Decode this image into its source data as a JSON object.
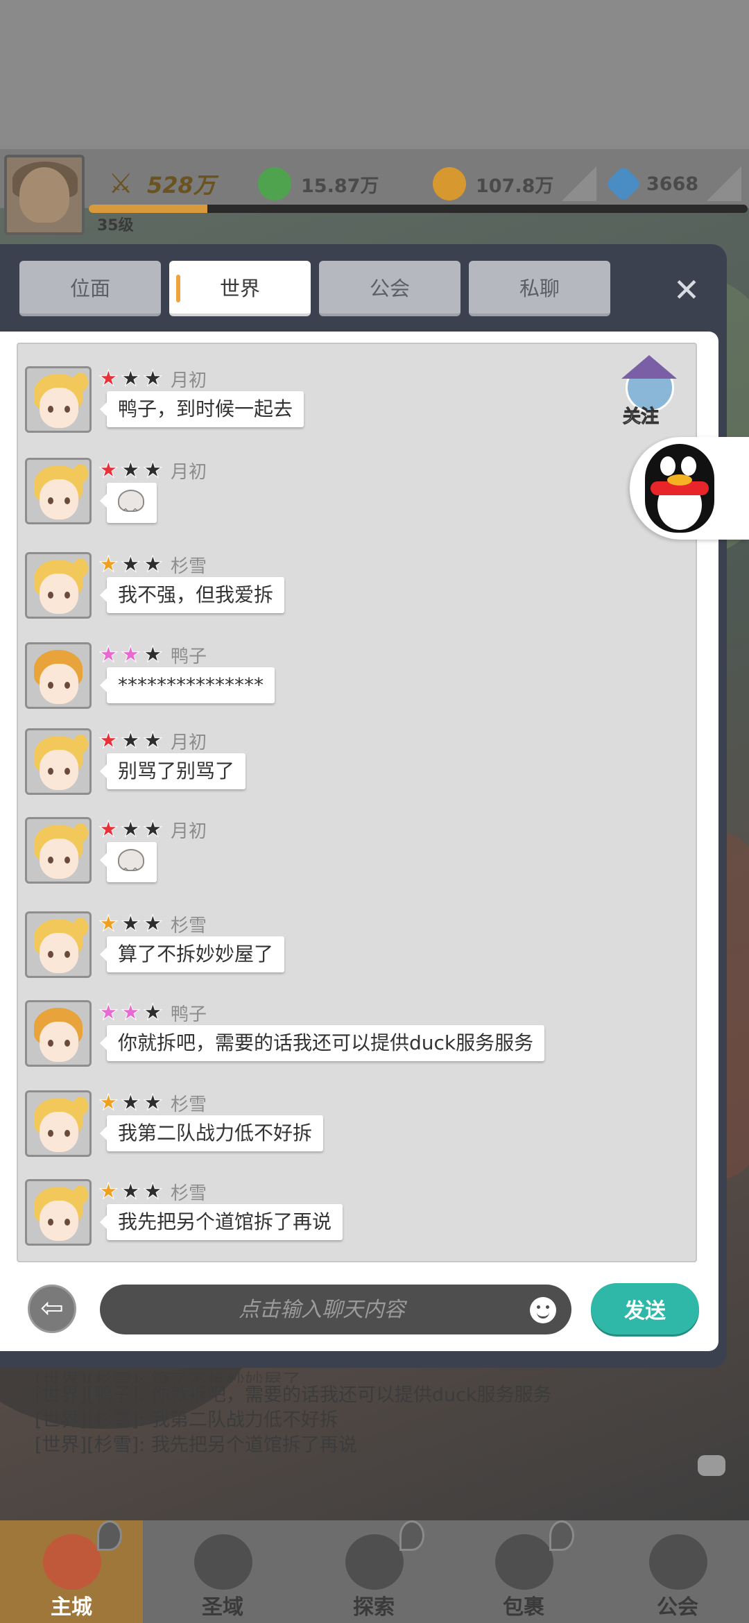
{
  "resources": {
    "power": "528万",
    "green_currency": "15.87万",
    "gold": "107.8万",
    "gem": "3668",
    "level": "35级",
    "exp_progress": 0.18
  },
  "tabs": [
    {
      "label": "位面",
      "active": false
    },
    {
      "label": "世界",
      "active": true
    },
    {
      "label": "公会",
      "active": false
    },
    {
      "label": "私聊",
      "active": false
    }
  ],
  "follow": {
    "label": "关注"
  },
  "messages": [
    {
      "name": "月初",
      "text": "鸭子，到时候一起去",
      "stars": [
        "#e8323a",
        "#2e2e2e",
        "#2e2e2e"
      ],
      "avatar": "blonde",
      "emoji": false
    },
    {
      "name": "月初",
      "text": "",
      "stars": [
        "#e8323a",
        "#2e2e2e",
        "#2e2e2e"
      ],
      "avatar": "blonde",
      "emoji": true
    },
    {
      "name": "杉雪",
      "text": "我不强，但我爱拆",
      "stars": [
        "#f0a020",
        "#2e2e2e",
        "#2e2e2e"
      ],
      "avatar": "blonde",
      "emoji": false
    },
    {
      "name": "鸭子",
      "text": "***************",
      "stars": [
        "#e86ad0",
        "#e86ad0",
        "#2e2e2e"
      ],
      "avatar": "boy",
      "emoji": false
    },
    {
      "name": "月初",
      "text": "别骂了别骂了",
      "stars": [
        "#e8323a",
        "#2e2e2e",
        "#2e2e2e"
      ],
      "avatar": "blonde",
      "emoji": false
    },
    {
      "name": "月初",
      "text": "",
      "stars": [
        "#e8323a",
        "#2e2e2e",
        "#2e2e2e"
      ],
      "avatar": "blonde",
      "emoji": true
    },
    {
      "name": "杉雪",
      "text": "算了不拆妙妙屋了",
      "stars": [
        "#f0a020",
        "#2e2e2e",
        "#2e2e2e"
      ],
      "avatar": "blonde",
      "emoji": false
    },
    {
      "name": "鸭子",
      "text": "你就拆吧，需要的话我还可以提供duck服务服务",
      "stars": [
        "#e86ad0",
        "#e86ad0",
        "#2e2e2e"
      ],
      "avatar": "boy",
      "emoji": false
    },
    {
      "name": "杉雪",
      "text": "我第二队战力低不好拆",
      "stars": [
        "#f0a020",
        "#2e2e2e",
        "#2e2e2e"
      ],
      "avatar": "blonde",
      "emoji": false
    },
    {
      "name": "杉雪",
      "text": "我先把另个道馆拆了再说",
      "stars": [
        "#f0a020",
        "#2e2e2e",
        "#2e2e2e"
      ],
      "avatar": "blonde",
      "emoji": false
    }
  ],
  "input": {
    "placeholder": "点击输入聊天内容",
    "value": ""
  },
  "send_label": "发送",
  "world_log": [
    "[世界][鸭子]: 你就拆吧，需要的话我还可以提供duck服务服务",
    "[世界][杉雪]: 我第二队战力低不好拆",
    "[世界][杉雪]: 我先把另个道馆拆了再说"
  ],
  "world_log_partial": [
    "[世界][杉雪]: 算了不拆妙妙屋了"
  ],
  "nav": [
    {
      "label": "主城",
      "active": true
    },
    {
      "label": "圣域",
      "active": false
    },
    {
      "label": "探索",
      "active": false
    },
    {
      "label": "包裹",
      "active": false
    },
    {
      "label": "公会",
      "active": false
    }
  ],
  "colors": {
    "send": "#2fb8a8",
    "tab_marker": "#f0a23c",
    "panel": "#3c4150"
  }
}
